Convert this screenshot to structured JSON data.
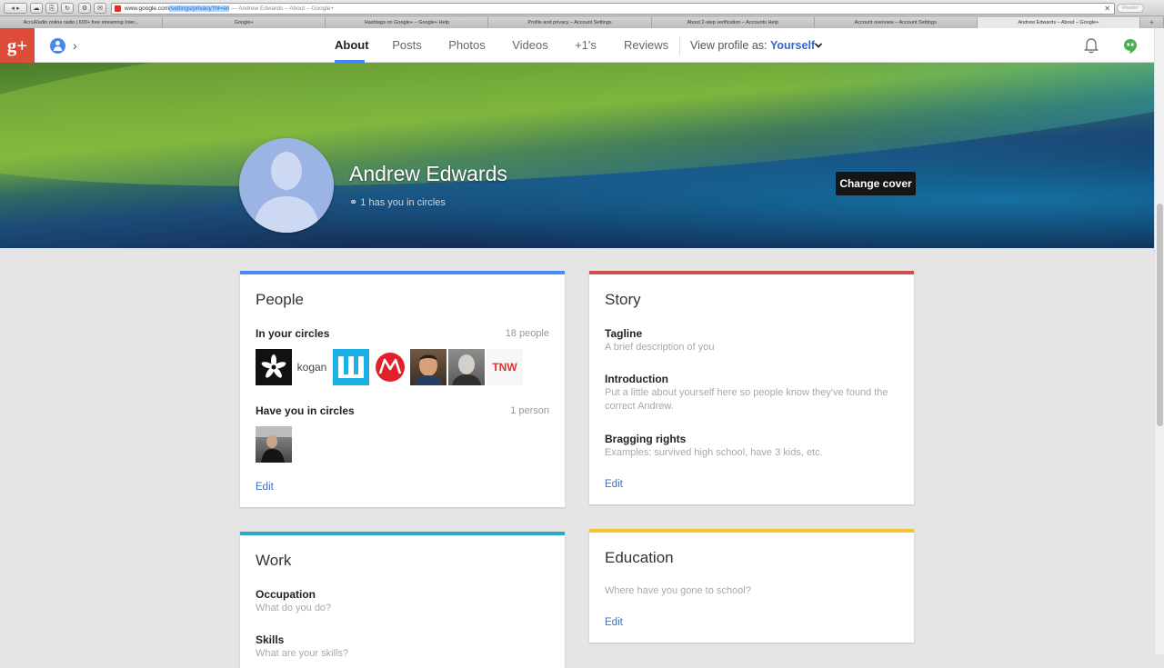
{
  "browser": {
    "url_host": "www.google.com",
    "url_path": "/settings/privacy?hl=en",
    "url_title": "— Andrew Edwards – About – Google+",
    "reader_label": "Reader",
    "tabs": [
      "AccuRadio online radio | 600+ free streaming Inter...",
      "Google+",
      "Hashtags on Google+ – Google+ Help",
      "Profile and privacy – Account Settings",
      "About 2-step verification – Accounts Help",
      "Account overview – Account Settings",
      "Andrew Edwards – About – Google+"
    ],
    "tab_add": "+"
  },
  "header": {
    "logo": "g+",
    "nav_tabs": [
      "About",
      "Posts",
      "Photos",
      "Videos",
      "+1's",
      "Reviews"
    ],
    "view_profile_label": "View profile as:",
    "view_profile_value": "Yourself"
  },
  "profile": {
    "name": "Andrew Edwards",
    "circles_text": "1 has you in circles",
    "change_cover": "Change cover"
  },
  "people": {
    "title": "People",
    "in_circles_label": "In your circles",
    "in_circles_count": "18 people",
    "in_circles_items": [
      "Adafruit",
      "kogan",
      "Wuaki",
      "Motorola",
      "Person 1",
      "Person 2",
      "TNW"
    ],
    "kogan_text": "kogan",
    "tnw_text": "TNW",
    "have_you_label": "Have you in circles",
    "have_you_count": "1 person",
    "edit": "Edit"
  },
  "story": {
    "title": "Story",
    "tagline_label": "Tagline",
    "tagline_value": "A brief description of you",
    "intro_label": "Introduction",
    "intro_value": "Put a little about yourself here so people know they've found the correct Andrew.",
    "bragging_label": "Bragging rights",
    "bragging_value": "Examples: survived high school, have 3 kids, etc.",
    "edit": "Edit"
  },
  "work": {
    "title": "Work",
    "occupation_label": "Occupation",
    "occupation_value": "What do you do?",
    "skills_label": "Skills",
    "skills_value": "What are your skills?"
  },
  "education": {
    "title": "Education",
    "value": "Where have you gone to school?",
    "edit": "Edit"
  },
  "colors": {
    "people_bar": "#4a8af4",
    "story_bar": "#c9514a",
    "work_bar": "#2aaac2",
    "education_bar": "#f0c531",
    "link": "#3b6ec4",
    "brand": "#dd4b39"
  }
}
